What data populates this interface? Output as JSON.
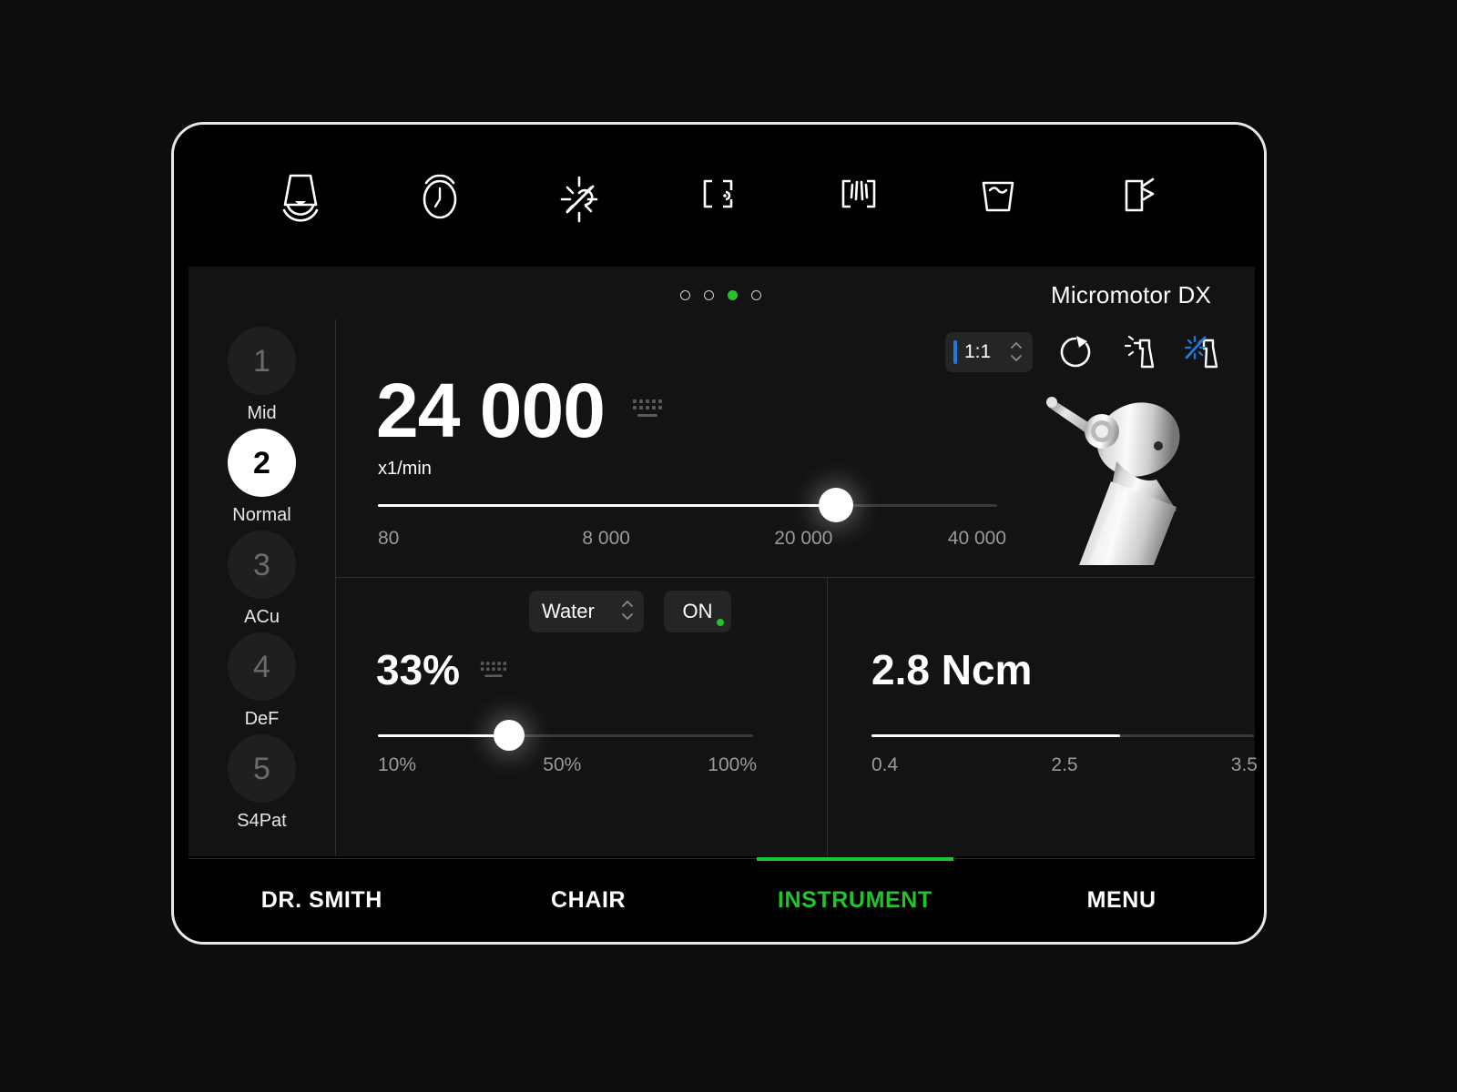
{
  "device": {
    "screen_title": "Micromotor DX",
    "page_dots": {
      "count": 4,
      "active_index": 2,
      "active_color": "#22c32c"
    }
  },
  "topbar": {
    "icons": [
      {
        "name": "ultrasonic-scaler-icon",
        "label": "Scaler"
      },
      {
        "name": "timer-icon",
        "label": "Timer"
      },
      {
        "name": "curing-light-icon",
        "label": "Curing Light"
      },
      {
        "name": "chair-position-icon",
        "label": "Chair Position"
      },
      {
        "name": "chair-back-icon",
        "label": "Chair Back"
      },
      {
        "name": "cup-fill-icon",
        "label": "Cup Fill"
      },
      {
        "name": "bowl-rinse-icon",
        "label": "Bowl Rinse"
      }
    ]
  },
  "presets": {
    "items": [
      {
        "number": "1",
        "label": "Mid",
        "selected": false
      },
      {
        "number": "2",
        "label": "Normal",
        "selected": true
      },
      {
        "number": "3",
        "label": "ACu",
        "selected": false
      },
      {
        "number": "4",
        "label": "DeF",
        "selected": false
      },
      {
        "number": "5",
        "label": "S4Pat",
        "selected": false
      }
    ]
  },
  "speed": {
    "ratio_value": "1:1",
    "ratio_accent_color": "#1f7ae0",
    "value": "24 000",
    "unit": "x1/min",
    "keypad_icon": "keyboard-icon",
    "slider": {
      "min_label": "80",
      "ticks": [
        "80",
        "8 000",
        "20 000",
        "40 000"
      ],
      "fill_percent": 74
    },
    "controls": [
      {
        "name": "reverse-rotation-icon",
        "active": false
      },
      {
        "name": "spray-no-light-icon",
        "active": false
      },
      {
        "name": "spray-light-icon",
        "active": true,
        "color": "#1f7ae0"
      }
    ]
  },
  "coolant": {
    "medium_label": "Water",
    "power_label": "ON",
    "power_indicator_color": "#22c32c",
    "value": "33%",
    "keypad_icon": "keyboard-icon",
    "slider": {
      "ticks": [
        "10%",
        "50%",
        "100%"
      ],
      "fill_percent": 35
    }
  },
  "torque": {
    "value": "2.8 Ncm",
    "slider": {
      "ticks": [
        "0.4",
        "2.5",
        "3.5"
      ],
      "fill_percent": 65
    }
  },
  "bottom_nav": {
    "items": [
      {
        "label": "DR. SMITH",
        "active": false
      },
      {
        "label": "CHAIR",
        "active": false
      },
      {
        "label": "INSTRUMENT",
        "active": true
      },
      {
        "label": "MENU",
        "active": false
      }
    ],
    "active_color": "#22c32c"
  }
}
